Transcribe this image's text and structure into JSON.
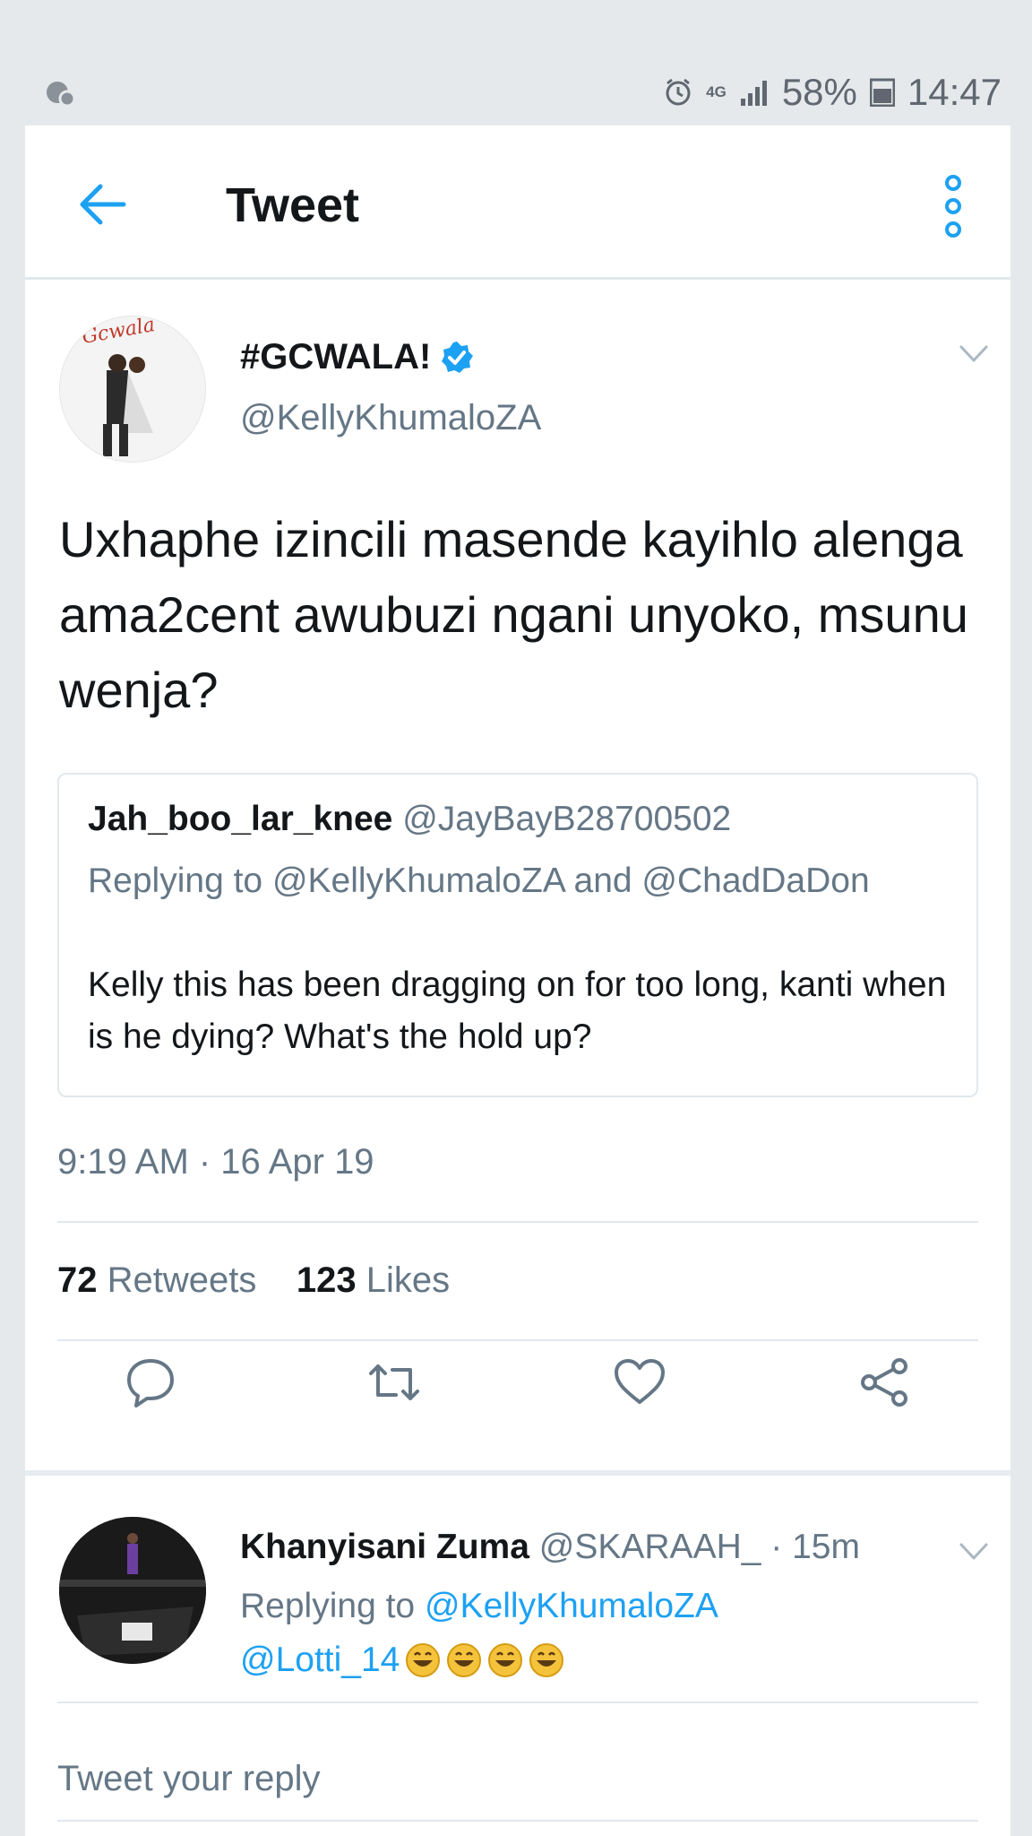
{
  "status_bar": {
    "network": "4G",
    "battery": "58%",
    "time": "14:47"
  },
  "app_bar": {
    "title": "Tweet"
  },
  "tweet": {
    "display_name": "#GCWALA!",
    "handle": "@KellyKhumaloZA",
    "avatar_text": "Gcwala",
    "text": "Uxhaphe izincili masende kayihlo alenga ama2cent awubuzi ngani unyoko, msunu wenja?",
    "quote": {
      "name": "Jah_boo_lar_knee",
      "handle": "@JayBayB28700502",
      "replying_to": "Replying to @KellyKhumaloZA and @ChadDaDon",
      "text": "Kelly this has been dragging on for too long, kanti when is he dying? What's the hold up?"
    },
    "timestamp": "9:19 AM · 16 Apr 19",
    "retweets_count": "72",
    "retweets_label": "Retweets",
    "likes_count": "123",
    "likes_label": "Likes"
  },
  "reply": {
    "name": "Khanyisani Zuma",
    "handle": "@SKARAAH_",
    "time": "· 15m",
    "replying_prefix": "Replying to",
    "replying_to": "@KellyKhumaloZA",
    "mention": "@Lotti_14",
    "emoji_icon": "grinning-face-emoji"
  },
  "composer": {
    "placeholder": "Tweet your reply"
  },
  "colors": {
    "accent": "#1da1f2",
    "muted": "#657786",
    "divider": "#e1e8ed",
    "background": "#e6e9ec"
  }
}
